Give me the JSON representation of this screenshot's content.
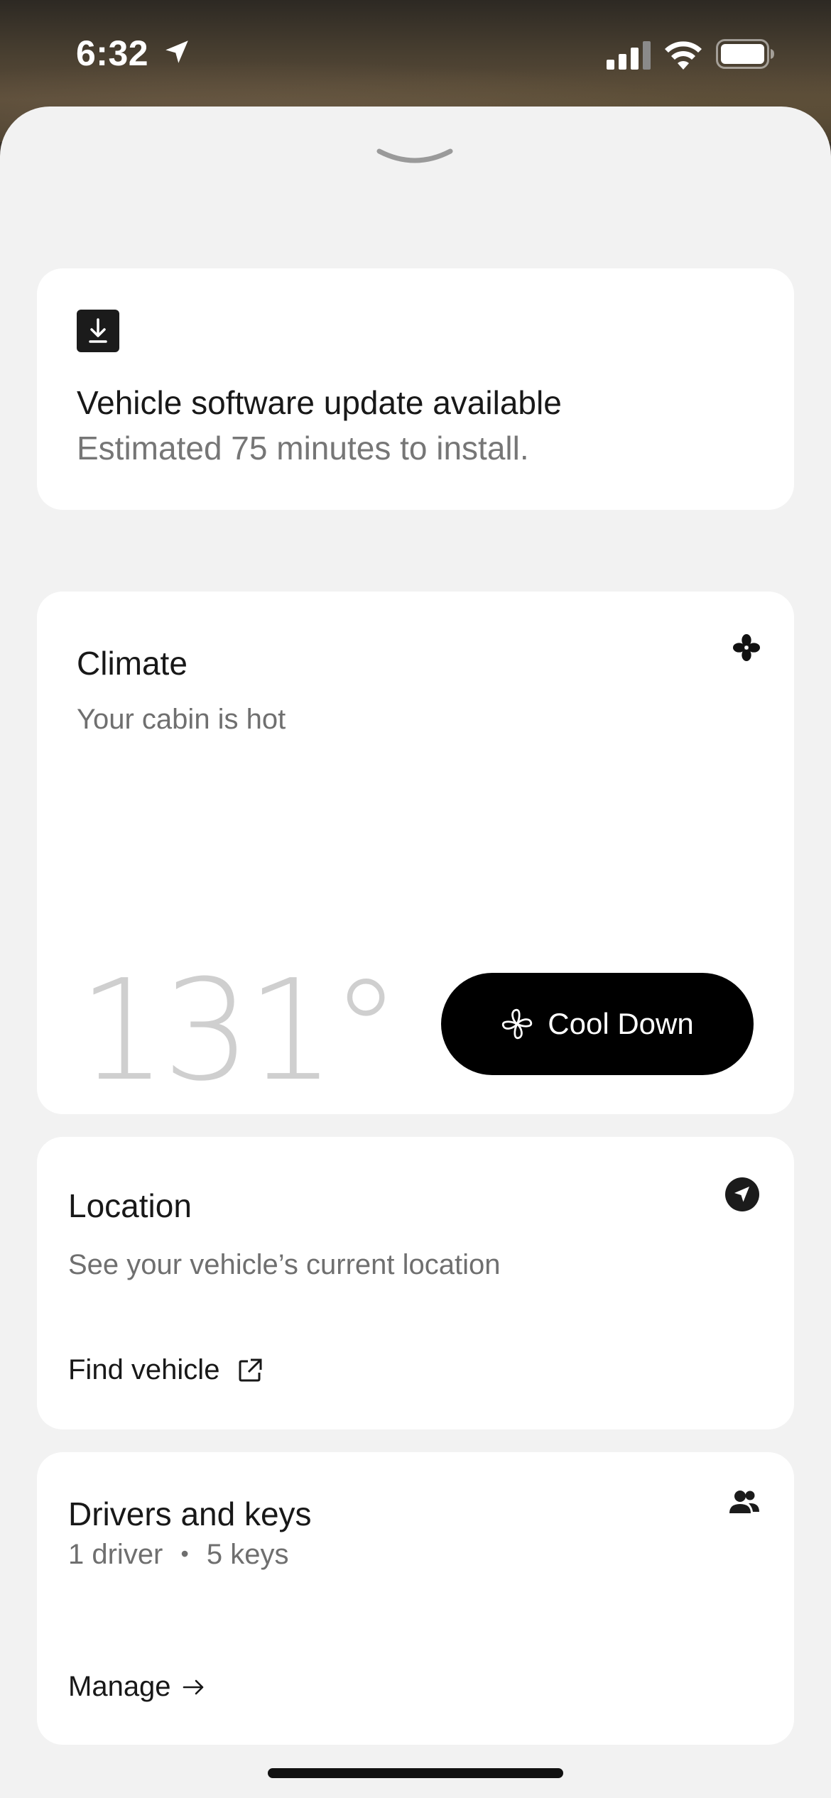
{
  "status_bar": {
    "time": "6:32"
  },
  "update": {
    "title": "Vehicle software update available",
    "subtitle": "Estimated 75 minutes to install.",
    "icon": "download-icon"
  },
  "climate": {
    "title": "Climate",
    "subtitle": "Your cabin is hot",
    "temperature": "131°",
    "button_label": "Cool Down",
    "icon": "fan-icon"
  },
  "location": {
    "title": "Location",
    "subtitle": "See your vehicle’s current location",
    "link_label": "Find vehicle",
    "icon": "navigation-icon"
  },
  "drivers": {
    "title": "Drivers and keys",
    "drivers_count": "1 driver",
    "separator": "•",
    "keys_count": "5 keys",
    "link_label": "Manage",
    "icon": "people-icon"
  },
  "colors": {
    "sheet_background": "#f2f2f2",
    "card": "#ffffff",
    "primary_button": "#000000",
    "temperature_text": "#cfcfcf"
  }
}
